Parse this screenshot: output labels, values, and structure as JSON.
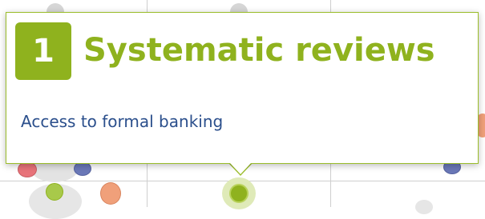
{
  "popup": {
    "number": "1",
    "title": "Systematic reviews",
    "link_label": "Access to formal banking"
  },
  "colors": {
    "accent_green": "#8fb21e",
    "link_blue": "#2b4f8c",
    "dot_gray": "#cfcfcf",
    "dot_blue": "#6a78b8",
    "dot_red": "#e8737a",
    "dot_orange": "#f0a07a"
  }
}
